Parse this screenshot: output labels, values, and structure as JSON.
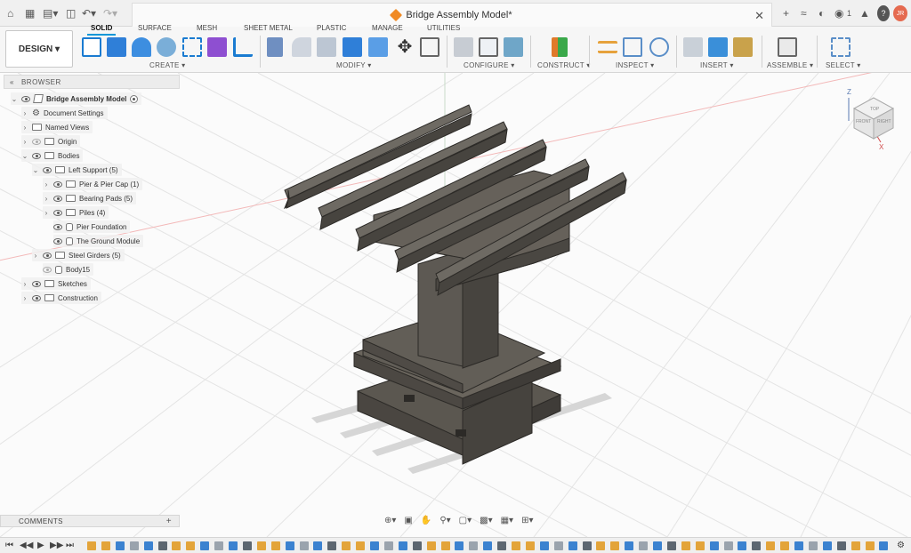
{
  "titlebar": {
    "document_title": "Bridge Assembly Model*",
    "notification_count": "1",
    "user_initials": "JR",
    "icons": [
      "home-icon",
      "grid-icon",
      "file-icon",
      "save-icon",
      "undo-icon",
      "redo-icon",
      "add-tab-icon",
      "offline-icon",
      "job-status-icon",
      "bell-icon",
      "help-icon"
    ]
  },
  "toolbar": {
    "workspace_label": "DESIGN",
    "tabs": [
      "SOLID",
      "SURFACE",
      "MESH",
      "SHEET METAL",
      "PLASTIC",
      "MANAGE",
      "UTILITIES"
    ],
    "groups": [
      "CREATE",
      "MODIFY",
      "CONFIGURE",
      "CONSTRUCT",
      "INSPECT",
      "INSERT",
      "ASSEMBLE",
      "SELECT"
    ]
  },
  "browser": {
    "header": "BROWSER",
    "items": [
      {
        "label": "Bridge Assembly Model"
      },
      {
        "label": "Document Settings"
      },
      {
        "label": "Named Views"
      },
      {
        "label": "Origin"
      },
      {
        "label": "Bodies"
      },
      {
        "label": "Left Support (5)"
      },
      {
        "label": "Pier & Pier Cap (1)"
      },
      {
        "label": "Bearing Pads (5)"
      },
      {
        "label": "Piles (4)"
      },
      {
        "label": "Pier Foundation"
      },
      {
        "label": "The Ground Module"
      },
      {
        "label": "Steel Girders (5)"
      },
      {
        "label": "Body15"
      },
      {
        "label": "Sketches"
      },
      {
        "label": "Construction"
      }
    ]
  },
  "comments": {
    "label": "COMMENTS"
  },
  "viewcube": {
    "top": "TOP",
    "front": "FRONT",
    "right": "RIGHT",
    "z": "Z",
    "x": "X"
  },
  "colors": {
    "accent": "#0696d7",
    "model": "#5a5650",
    "model_dark": "#3f3c38",
    "model_light": "#77726b"
  }
}
